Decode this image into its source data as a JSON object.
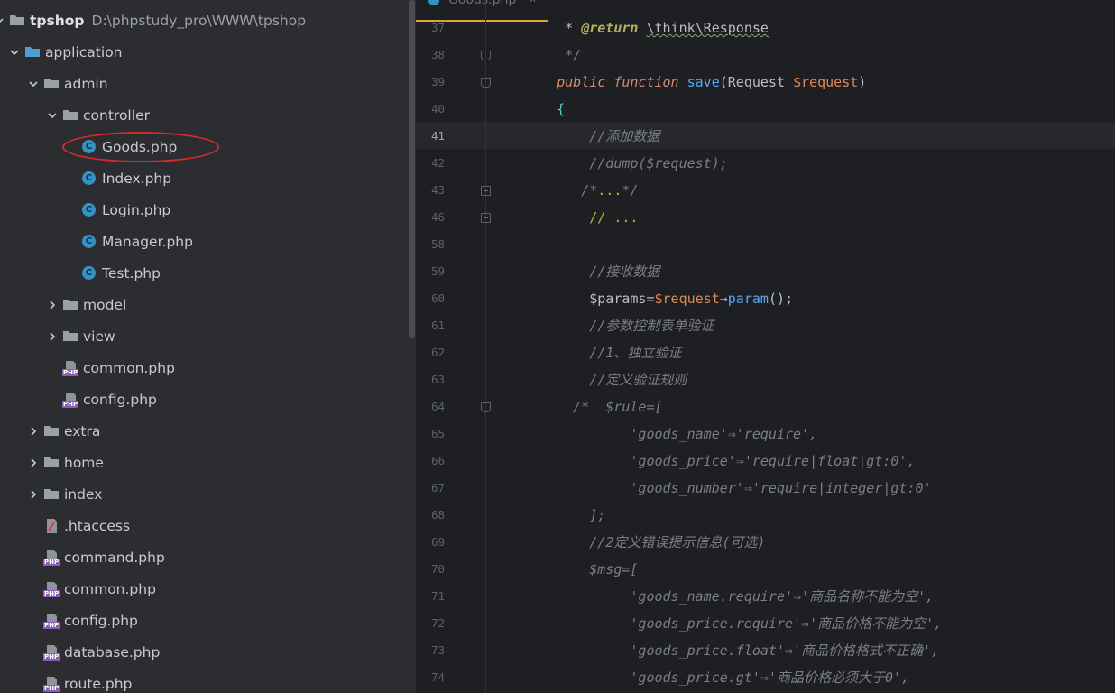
{
  "sidebar": {
    "rows": [
      {
        "label": "tpshop",
        "path": "D:\\phpstudy_pro\\WWW\\tpshop",
        "indent": 0,
        "type": "root",
        "chevron": "down"
      },
      {
        "label": "application",
        "indent": 1,
        "type": "folder-blue",
        "chevron": "down"
      },
      {
        "label": "admin",
        "indent": 2,
        "type": "folder",
        "chevron": "down"
      },
      {
        "label": "controller",
        "indent": 3,
        "type": "folder",
        "chevron": "down"
      },
      {
        "label": "Goods.php",
        "indent": 4,
        "type": "class"
      },
      {
        "label": "Index.php",
        "indent": 4,
        "type": "class"
      },
      {
        "label": "Login.php",
        "indent": 4,
        "type": "class"
      },
      {
        "label": "Manager.php",
        "indent": 4,
        "type": "class"
      },
      {
        "label": "Test.php",
        "indent": 4,
        "type": "class"
      },
      {
        "label": "model",
        "indent": 3,
        "type": "folder",
        "chevron": "right"
      },
      {
        "label": "view",
        "indent": 3,
        "type": "folder",
        "chevron": "right"
      },
      {
        "label": "common.php",
        "indent": 3,
        "type": "php"
      },
      {
        "label": "config.php",
        "indent": 3,
        "type": "php"
      },
      {
        "label": "extra",
        "indent": 2,
        "type": "folder",
        "chevron": "right"
      },
      {
        "label": "home",
        "indent": 2,
        "type": "folder",
        "chevron": "right"
      },
      {
        "label": "index",
        "indent": 2,
        "type": "folder",
        "chevron": "right"
      },
      {
        "label": ".htaccess",
        "indent": 2,
        "type": "htaccess"
      },
      {
        "label": "command.php",
        "indent": 2,
        "type": "php"
      },
      {
        "label": "common.php",
        "indent": 2,
        "type": "php"
      },
      {
        "label": "config.php",
        "indent": 2,
        "type": "php"
      },
      {
        "label": "database.php",
        "indent": 2,
        "type": "php"
      },
      {
        "label": "route.php",
        "indent": 2,
        "type": "php"
      }
    ]
  },
  "editor": {
    "tab_label": "Goods.php",
    "tab_close": "×",
    "current_line": "41",
    "lines": [
      {
        "n": "37",
        "fold": "",
        "segments": [
          [
            "punc",
            "     * "
          ],
          [
            "ann",
            "@return"
          ],
          [
            "punc",
            " "
          ],
          [
            "squig",
            "\\think\\Response"
          ]
        ]
      },
      {
        "n": "38",
        "fold": "tri",
        "segments": [
          [
            "cm",
            "     */"
          ]
        ]
      },
      {
        "n": "39",
        "fold": "tri",
        "segments": [
          [
            "kw",
            "    public function "
          ],
          [
            "fn",
            "save"
          ],
          [
            "punc",
            "(Request "
          ],
          [
            "var",
            "$request"
          ],
          [
            "punc",
            ")"
          ]
        ]
      },
      {
        "n": "40",
        "fold": "",
        "segments": [
          [
            "brace",
            "    {"
          ]
        ]
      },
      {
        "n": "41",
        "fold": "",
        "segments": [
          [
            "cm",
            "        //添加数据"
          ]
        ]
      },
      {
        "n": "42",
        "fold": "",
        "segments": [
          [
            "cm",
            "        //dump($request);"
          ]
        ]
      },
      {
        "n": "43",
        "fold": "box",
        "segments": [
          [
            "cm",
            "       /*"
          ],
          [
            "fold-txt",
            "..."
          ],
          [
            "cm",
            "*/"
          ]
        ]
      },
      {
        "n": "46",
        "fold": "box",
        "segments": [
          [
            "fold-txt",
            "        // ..."
          ]
        ]
      },
      {
        "n": "58",
        "fold": "",
        "segments": []
      },
      {
        "n": "59",
        "fold": "",
        "segments": [
          [
            "cm",
            "        //接收数据"
          ]
        ]
      },
      {
        "n": "60",
        "fold": "",
        "segments": [
          [
            "punc",
            "        $params="
          ],
          [
            "var",
            "$request"
          ],
          [
            "punc",
            "→"
          ],
          [
            "fn",
            "param"
          ],
          [
            "punc",
            "();"
          ]
        ]
      },
      {
        "n": "61",
        "fold": "",
        "segments": [
          [
            "cm",
            "        //参数控制表单验证"
          ]
        ]
      },
      {
        "n": "62",
        "fold": "",
        "segments": [
          [
            "cm",
            "        //1、独立验证"
          ]
        ]
      },
      {
        "n": "63",
        "fold": "",
        "segments": [
          [
            "cm",
            "        //定义验证规则"
          ]
        ]
      },
      {
        "n": "64",
        "fold": "tri",
        "segments": [
          [
            "cm",
            "      /*  $rule=["
          ]
        ]
      },
      {
        "n": "65",
        "fold": "",
        "segments": [
          [
            "cm",
            "             'goods_name'⇒'require',"
          ]
        ]
      },
      {
        "n": "66",
        "fold": "",
        "segments": [
          [
            "cm",
            "             'goods_price'⇒'require|float|gt:0',"
          ]
        ]
      },
      {
        "n": "67",
        "fold": "",
        "segments": [
          [
            "cm",
            "             'goods_number'⇒'require|integer|gt:0'"
          ]
        ]
      },
      {
        "n": "68",
        "fold": "",
        "segments": [
          [
            "cm",
            "        ];"
          ]
        ]
      },
      {
        "n": "69",
        "fold": "",
        "segments": [
          [
            "cm",
            "        //2定义错误提示信息(可选)"
          ]
        ]
      },
      {
        "n": "70",
        "fold": "",
        "segments": [
          [
            "cm",
            "        $msg=["
          ]
        ]
      },
      {
        "n": "71",
        "fold": "",
        "segments": [
          [
            "cm",
            "             'goods_name.require'⇒'商品名称不能为空',"
          ]
        ]
      },
      {
        "n": "72",
        "fold": "",
        "segments": [
          [
            "cm",
            "             'goods_price.require'⇒'商品价格不能为空',"
          ]
        ]
      },
      {
        "n": "73",
        "fold": "",
        "segments": [
          [
            "cm",
            "             'goods_price.float'⇒'商品价格格式不正确',"
          ]
        ]
      },
      {
        "n": "74",
        "fold": "",
        "segments": [
          [
            "cm",
            "             'goods_price.gt'⇒'商品价格必须大于0',"
          ]
        ]
      }
    ]
  },
  "colors": {
    "accent_tab": "#e0a33a",
    "annotation_circle": "#d42a2a",
    "class_icon": "#3592c4",
    "php_icon": "#8a5fb3"
  }
}
